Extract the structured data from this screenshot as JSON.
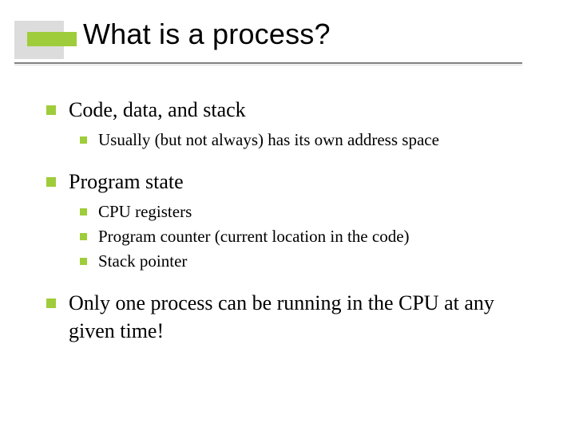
{
  "title": "What is a process?",
  "items": [
    {
      "text": "Code, data, and stack",
      "sub": [
        "Usually (but not always) has its own address space"
      ]
    },
    {
      "text": "Program state",
      "sub": [
        "CPU registers",
        "Program counter (current location in the code)",
        "Stack pointer"
      ]
    },
    {
      "text": "Only one process can be running in the CPU at any given time!",
      "sub": []
    }
  ]
}
